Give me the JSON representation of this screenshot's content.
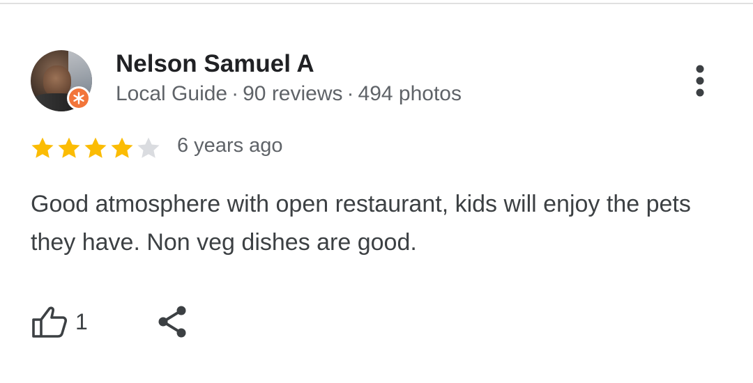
{
  "review": {
    "author": {
      "name": "Nelson Samuel A",
      "level": "Local Guide",
      "reviews": "90 reviews",
      "photos": "494 photos",
      "separator": "·",
      "avatar_icon": "profile-photo",
      "badge_icon": "local-guide-star-badge"
    },
    "rating": {
      "value": 4,
      "max": 5,
      "filled_color": "#fbbc04",
      "empty_color": "#dadce0"
    },
    "time": "6 years ago",
    "text": "Good atmosphere with open restaurant, kids will enjoy the pets they have. Non veg dishes are good.",
    "actions": {
      "like_icon": "thumb-up-icon",
      "like_count": "1",
      "share_icon": "share-icon",
      "more_icon": "more-vertical-icon"
    }
  }
}
